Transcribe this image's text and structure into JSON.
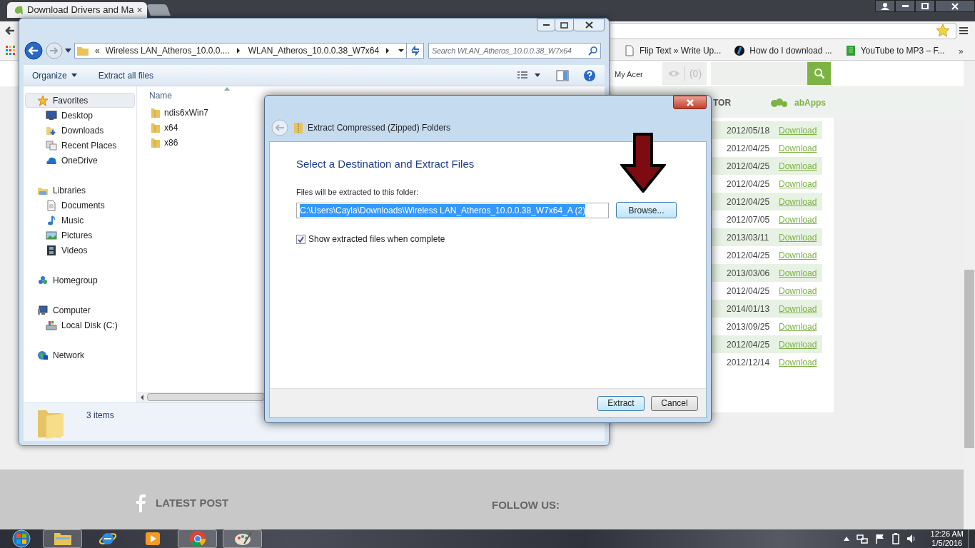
{
  "browser": {
    "tab": {
      "title": "Download Drivers and Ma",
      "close": "×"
    },
    "bookmarks": [
      {
        "label": "Flip Text » Write Up..."
      },
      {
        "label": "How do I download ..."
      },
      {
        "label": "YouTube to MP3 – F..."
      }
    ],
    "bookmarks_overflow": "»"
  },
  "page": {
    "header": {
      "account": "My Acer",
      "count": "(0)"
    },
    "nav": [
      {
        "label": "TOR"
      },
      {
        "label": "abApps"
      }
    ],
    "downloads": [
      {
        "date": "2012/05/18",
        "link": "Download"
      },
      {
        "date": "2012/04/25",
        "link": "Download"
      },
      {
        "date": "2012/04/25",
        "link": "Download"
      },
      {
        "date": "2012/04/25",
        "link": "Download"
      },
      {
        "date": "2012/04/25",
        "link": "Download"
      },
      {
        "date": "2012/07/05",
        "link": "Download"
      },
      {
        "date": "2013/03/11",
        "link": "Download"
      },
      {
        "date": "2012/04/25",
        "link": "Download"
      },
      {
        "date": "2013/03/06",
        "link": "Download"
      },
      {
        "date": "2012/04/25",
        "link": "Download"
      },
      {
        "date": "2014/01/13",
        "link": "Download"
      },
      {
        "date": "2013/09/25",
        "link": "Download"
      },
      {
        "date": "2012/04/25",
        "link": "Download"
      },
      {
        "date": "2012/12/14",
        "link": "Download"
      }
    ],
    "footer": {
      "latest_post": "LATEST POST",
      "follow_us": "FOLLOW US:"
    }
  },
  "explorer": {
    "breadcrumb_overflow": "«",
    "breadcrumb": [
      "Wireless LAN_Atheros_10.0.0....",
      "WLAN_Atheros_10.0.0.38_W7x64"
    ],
    "search": {
      "placeholder": "Search WLAN_Atheros_10.0.0.38_W7x64"
    },
    "toolbar": [
      "Organize",
      "Extract all files"
    ],
    "sidebar": [
      {
        "label": "Favorites",
        "selected": true,
        "children": [
          {
            "label": "Desktop",
            "selected": false
          },
          {
            "label": "Downloads",
            "selected": false
          },
          {
            "label": "Recent Places",
            "selected": false
          },
          {
            "label": "OneDrive",
            "selected": false
          }
        ]
      },
      {
        "label": "Libraries",
        "selected": false,
        "children": [
          {
            "label": "Documents",
            "selected": false
          },
          {
            "label": "Music",
            "selected": false
          },
          {
            "label": "Pictures",
            "selected": false
          },
          {
            "label": "Videos",
            "selected": false
          }
        ]
      },
      {
        "label": "Homegroup",
        "selected": false
      },
      {
        "label": "Computer",
        "selected": false,
        "children": [
          {
            "label": "Local Disk (C:)",
            "selected": false
          }
        ]
      },
      {
        "label": "Network",
        "selected": false
      }
    ],
    "columns": [
      "Name"
    ],
    "files": [
      "ndis6xWin7",
      "x64",
      "x86"
    ],
    "status": "3 items"
  },
  "dialog": {
    "title": "Extract Compressed (Zipped) Folders",
    "heading": "Select a Destination and Extract Files",
    "field_label": "Files will be extracted to this folder:",
    "path": {
      "value": "C:\\Users\\Cayla\\Downloads\\Wireless LAN_Atheros_10.0.0.38_W7x64_A (2)",
      "selected": true
    },
    "browse": "Browse...",
    "show_when_complete": {
      "label": "Show extracted files when complete",
      "checked": true
    },
    "buttons": [
      {
        "label": "Extract",
        "default": true
      },
      {
        "label": "Cancel",
        "default": false
      }
    ]
  },
  "taskbar": {
    "apps": [
      {
        "running": true
      },
      {
        "running": false
      },
      {
        "running": false
      },
      {
        "running": true
      },
      {
        "running": true
      }
    ],
    "time": "12:26 AM",
    "date": "1/5/2016"
  }
}
